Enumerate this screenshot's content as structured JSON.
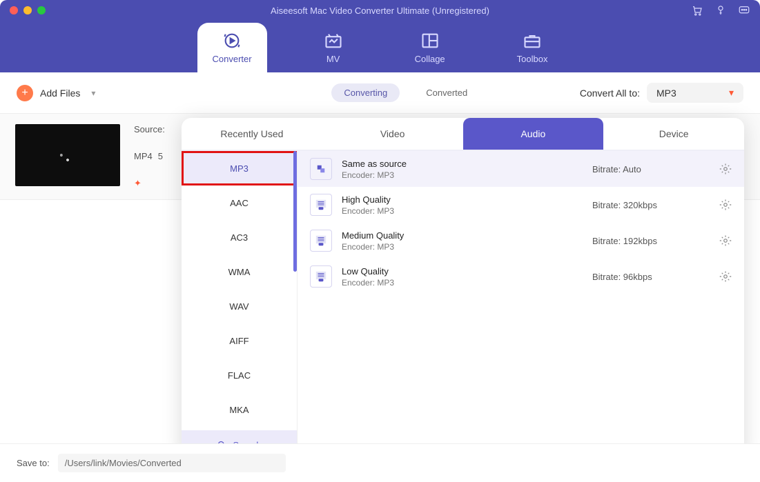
{
  "window": {
    "title": "Aiseesoft Mac Video Converter Ultimate (Unregistered)"
  },
  "tabs": [
    {
      "label": "Converter"
    },
    {
      "label": "MV"
    },
    {
      "label": "Collage"
    },
    {
      "label": "Toolbox"
    }
  ],
  "toolbar": {
    "add_files": "Add Files",
    "segment": {
      "converting": "Converting",
      "converted": "Converted"
    },
    "convert_all_label": "Convert All to:",
    "convert_all_value": "MP3"
  },
  "file": {
    "source_label": "Source:",
    "format": "MP4",
    "extra": "5"
  },
  "popup": {
    "tabs": [
      {
        "label": "Recently Used"
      },
      {
        "label": "Video"
      },
      {
        "label": "Audio"
      },
      {
        "label": "Device"
      }
    ],
    "formats": [
      "MP3",
      "AAC",
      "AC3",
      "WMA",
      "WAV",
      "AIFF",
      "FLAC",
      "MKA"
    ],
    "search_label": "Search",
    "presets": [
      {
        "name": "Same as source",
        "encoder": "Encoder: MP3",
        "bitrate": "Bitrate: Auto"
      },
      {
        "name": "High Quality",
        "encoder": "Encoder: MP3",
        "bitrate": "Bitrate: 320kbps"
      },
      {
        "name": "Medium Quality",
        "encoder": "Encoder: MP3",
        "bitrate": "Bitrate: 192kbps"
      },
      {
        "name": "Low Quality",
        "encoder": "Encoder: MP3",
        "bitrate": "Bitrate: 96kbps"
      }
    ]
  },
  "footer": {
    "save_to_label": "Save to:",
    "path": "/Users/link/Movies/Converted"
  }
}
